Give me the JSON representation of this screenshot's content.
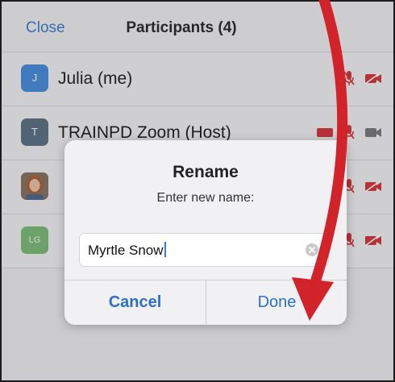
{
  "header": {
    "close_label": "Close",
    "title": "Participants (4)"
  },
  "participants": [
    {
      "initials": "J",
      "name": "Julia  (me)",
      "avatar_color": "#4a90e2",
      "mic": "mic-muted",
      "video": "video-off"
    },
    {
      "initials": "T",
      "name": "TRAINPD Zoom (Host)",
      "avatar_color": "#5f7586",
      "mic": "mic-muted",
      "video": "video-on"
    },
    {
      "initials": "",
      "name": "",
      "avatar_color": "#6d5a4e",
      "mic": "mic-muted",
      "video": "video-off"
    },
    {
      "initials": "LG",
      "name": "",
      "avatar_color": "#7fbf7a",
      "mic": "mic-muted",
      "video": "video-off"
    }
  ],
  "dialog": {
    "title": "Rename",
    "message": "Enter new name:",
    "input_value": "Myrtle Snow",
    "cancel_label": "Cancel",
    "done_label": "Done"
  },
  "colors": {
    "accent": "#3f7fd0",
    "muted_red": "#d9373e",
    "arrow_red": "#d2232a"
  }
}
